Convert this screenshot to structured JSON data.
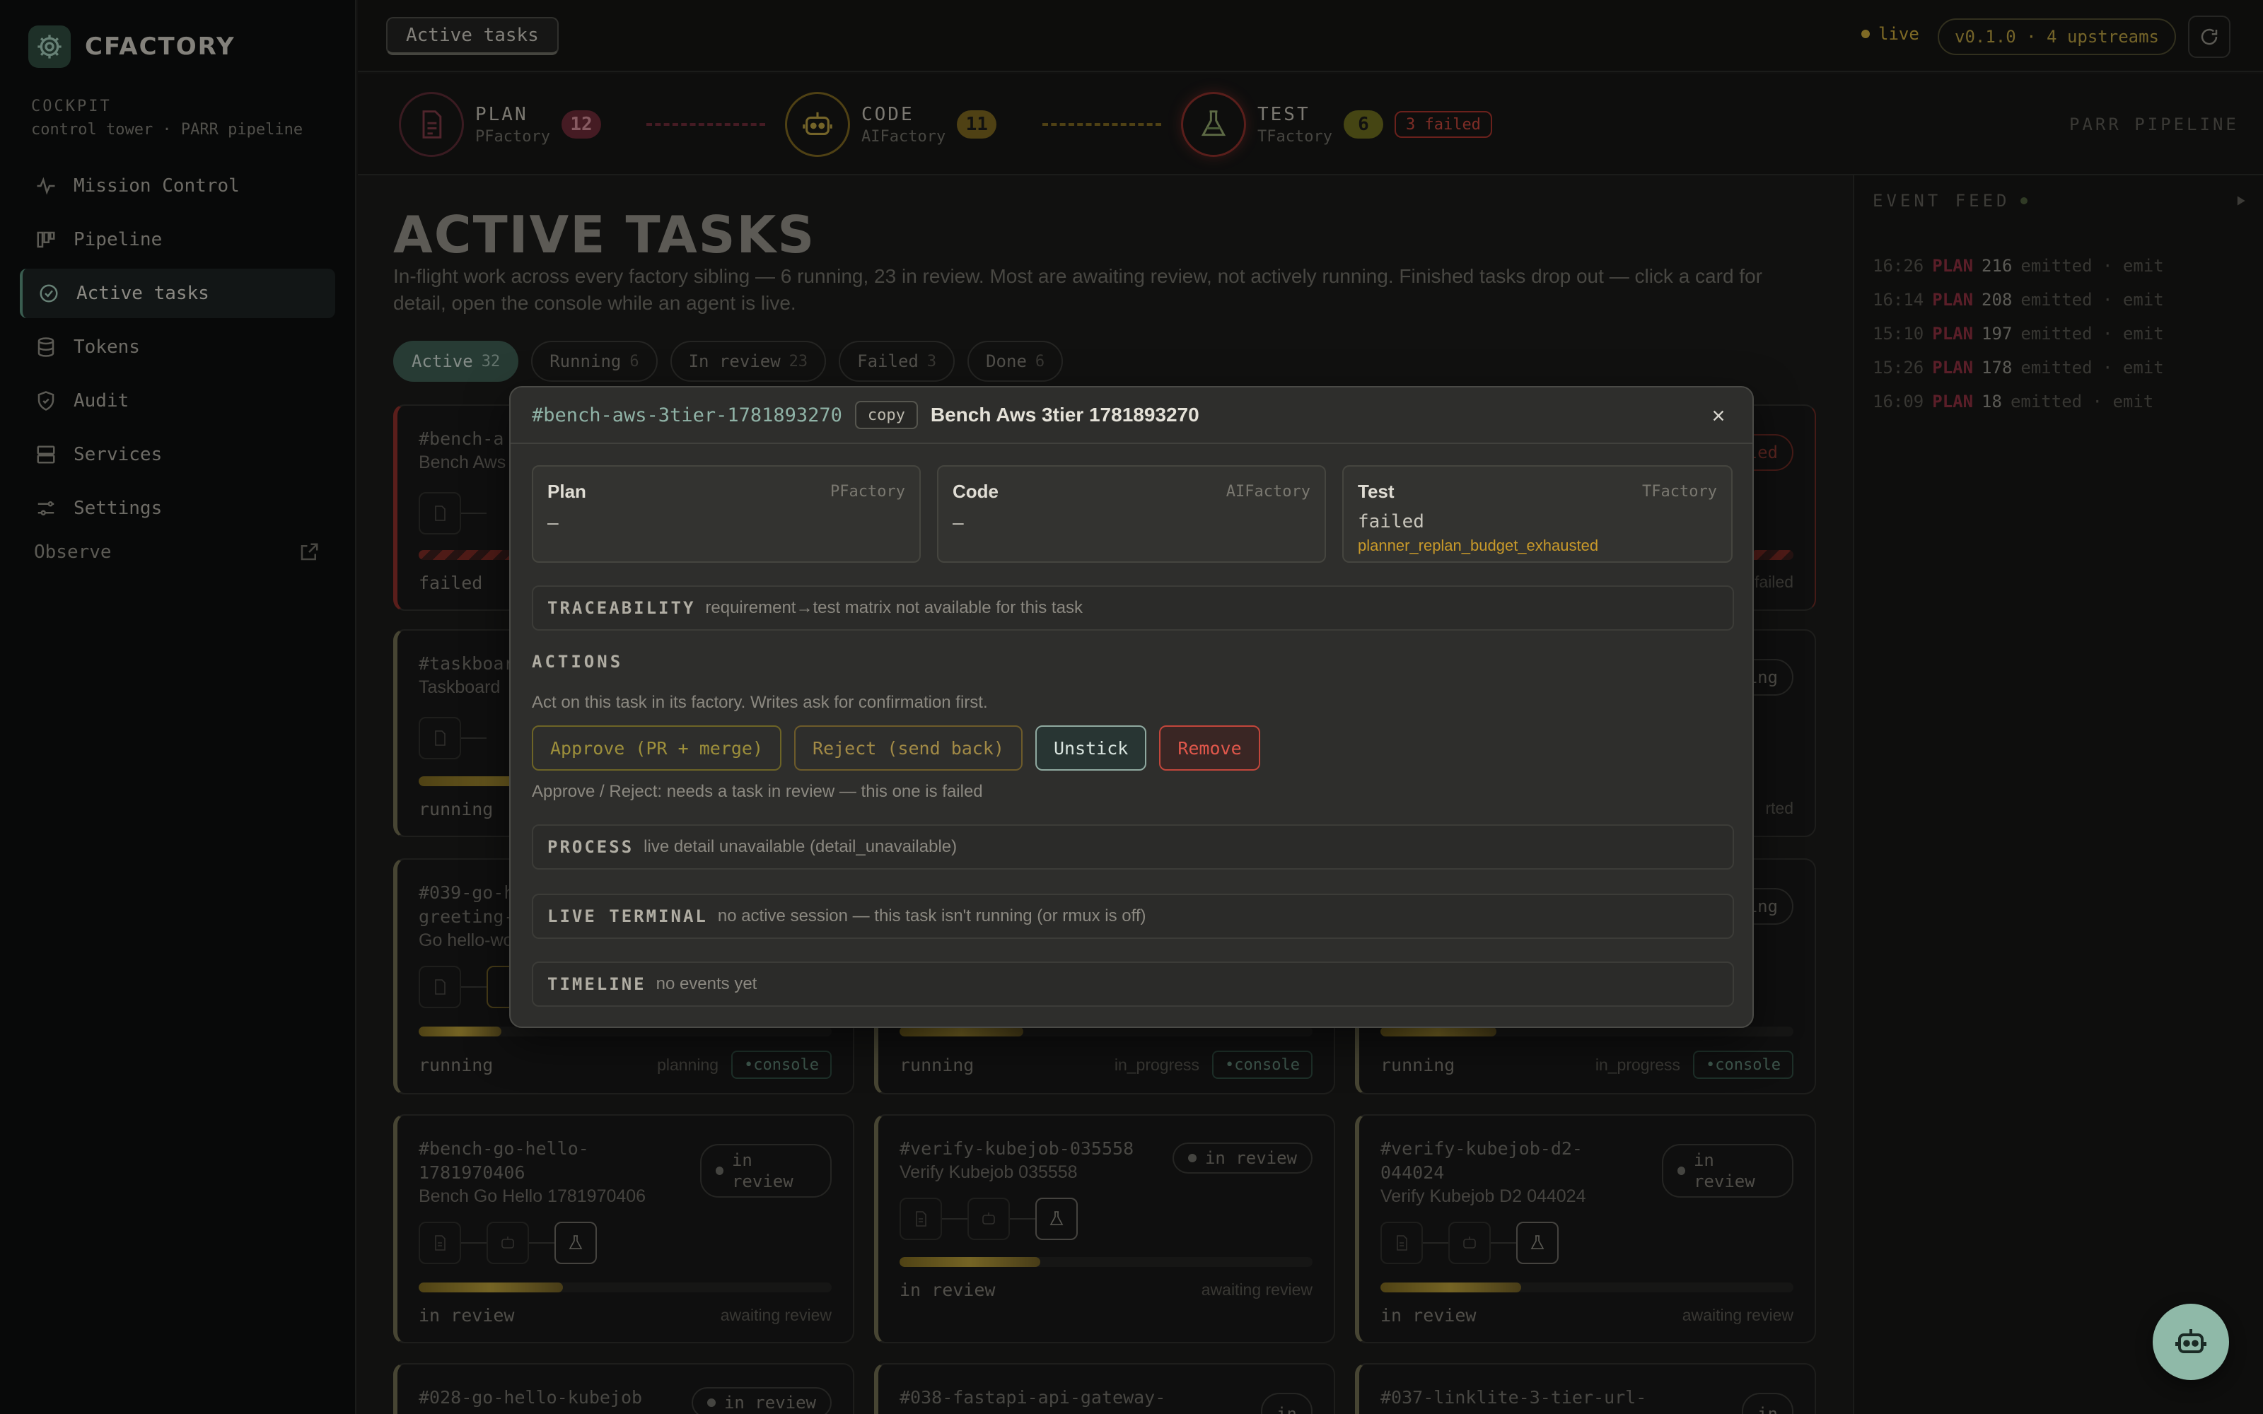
{
  "app": {
    "name": "CFACTORY"
  },
  "sidebar": {
    "cockpit_label": "COCKPIT",
    "cockpit_sub": "control tower · PARR pipeline",
    "items": [
      {
        "label": "Mission Control",
        "icon": "pulse-icon"
      },
      {
        "label": "Pipeline",
        "icon": "kanban-icon"
      },
      {
        "label": "Active tasks",
        "icon": "check-circle-icon",
        "active": true
      },
      {
        "label": "Tokens",
        "icon": "database-icon"
      },
      {
        "label": "Audit",
        "icon": "shield-check-icon"
      },
      {
        "label": "Services",
        "icon": "server-icon"
      },
      {
        "label": "Settings",
        "icon": "sliders-icon"
      }
    ],
    "observe": "Observe"
  },
  "topbar": {
    "breadcrumb": "Active tasks",
    "live": "live",
    "version": "v0.1.0 · 4 upstreams"
  },
  "pipeline": {
    "stages": [
      {
        "name": "PLAN",
        "factory": "PFactory",
        "count": "12"
      },
      {
        "name": "CODE",
        "factory": "AIFactory",
        "count": "11"
      },
      {
        "name": "TEST",
        "factory": "TFactory",
        "count": "6",
        "failed": "3 failed"
      }
    ],
    "label": "PARR PIPELINE"
  },
  "main": {
    "title": "ACTIVE TASKS",
    "description": "In-flight work across every factory sibling — 6 running, 23 in review. Most are awaiting review, not actively running. Finished tasks drop out — click a card for detail, open the console while an agent is live.",
    "filters": [
      {
        "label": "Active",
        "count": "32",
        "active": true
      },
      {
        "label": "Running",
        "count": "6"
      },
      {
        "label": "In review",
        "count": "23"
      },
      {
        "label": "Failed",
        "count": "3"
      },
      {
        "label": "Done",
        "count": "6"
      }
    ]
  },
  "cards": [
    {
      "id": "#bench-a",
      "name": "Bench Aws",
      "status": "failed",
      "right": "failed",
      "badge": "led"
    },
    {
      "id": "#taskboar",
      "name": "Taskboard",
      "status": "running",
      "right": "rted",
      "badge": "ing"
    },
    {
      "id": "#039-go-h",
      "id2": "greeting-",
      "name": "Go hello-wo",
      "status": "running",
      "phase": "planning",
      "console": "console"
    },
    {
      "id": "",
      "name": "",
      "status": "running",
      "phase": "in_progress",
      "console": "console"
    },
    {
      "id": "",
      "name": "",
      "status": "running",
      "phase": "in_progress",
      "console": "console",
      "badge": "ing"
    },
    {
      "id": "#bench-go-hello-",
      "id2": "1781970406",
      "name": "Bench Go Hello 1781970406",
      "badge": "in review",
      "status": "in review",
      "right": "awaiting review",
      "progress": 0.35
    },
    {
      "id": "#verify-kubejob-035558",
      "name": "Verify Kubejob 035558",
      "badge": "in review",
      "status": "in review",
      "right": "awaiting review",
      "progress": 0.34
    },
    {
      "id": "#verify-kubejob-d2-",
      "id2": "044024",
      "name": "Verify Kubejob D2 044024",
      "badge": "in review",
      "status": "in review",
      "right": "awaiting review",
      "progress": 0.34
    },
    {
      "id": "#028-go-hello-kubejob",
      "badge": "in review"
    },
    {
      "id": "#038-fastapi-api-gateway-",
      "badge": "in"
    },
    {
      "id": "#037-linklite-3-tier-url-",
      "badge": "in"
    }
  ],
  "feed": {
    "title": "EVENT FEED",
    "rows": [
      {
        "time": "16:26",
        "tag": "PLAN",
        "num": "216",
        "text": "emitted · emit"
      },
      {
        "time": "16:14",
        "tag": "PLAN",
        "num": "208",
        "text": "emitted · emit"
      },
      {
        "time": "15:10",
        "tag": "PLAN",
        "num": "197",
        "text": "emitted · emit"
      },
      {
        "time": "15:26",
        "tag": "PLAN",
        "num": "178",
        "text": "emitted · emit"
      },
      {
        "time": "16:09",
        "tag": "PLAN",
        "num": "18",
        "text": "emitted · emit"
      }
    ]
  },
  "modal": {
    "task_id": "#bench-aws-3tier-1781893270",
    "copy": "copy",
    "title": "Bench Aws 3tier 1781893270",
    "stages": [
      {
        "name": "Plan",
        "factory": "PFactory",
        "value": "—"
      },
      {
        "name": "Code",
        "factory": "AIFactory",
        "value": "—"
      },
      {
        "name": "Test",
        "factory": "TFactory",
        "value": "failed",
        "error": "planner_replan_budget_exhausted"
      }
    ],
    "traceability": {
      "key": "TRACEABILITY",
      "value": "requirement→test matrix not available for this task"
    },
    "actions": {
      "title": "ACTIONS",
      "desc": "Act on this task in its factory. Writes ask for confirmation first.",
      "approve": "Approve (PR + merge)",
      "reject": "Reject (send back)",
      "unstick": "Unstick",
      "remove": "Remove",
      "note": "Approve / Reject: needs a task in review — this one is failed"
    },
    "process": {
      "key": "PROCESS",
      "value": "live detail unavailable (detail_unavailable)"
    },
    "terminal": {
      "key": "LIVE TERMINAL",
      "value": "no active session — this task isn't running (or rmux is off)"
    },
    "timeline": {
      "key": "TIMELINE",
      "value": "no events yet"
    }
  },
  "colors": {
    "accent": "#5a8f7c",
    "warning": "#c4a33a",
    "danger": "#c2463b",
    "plan": "#8a2f3e"
  }
}
